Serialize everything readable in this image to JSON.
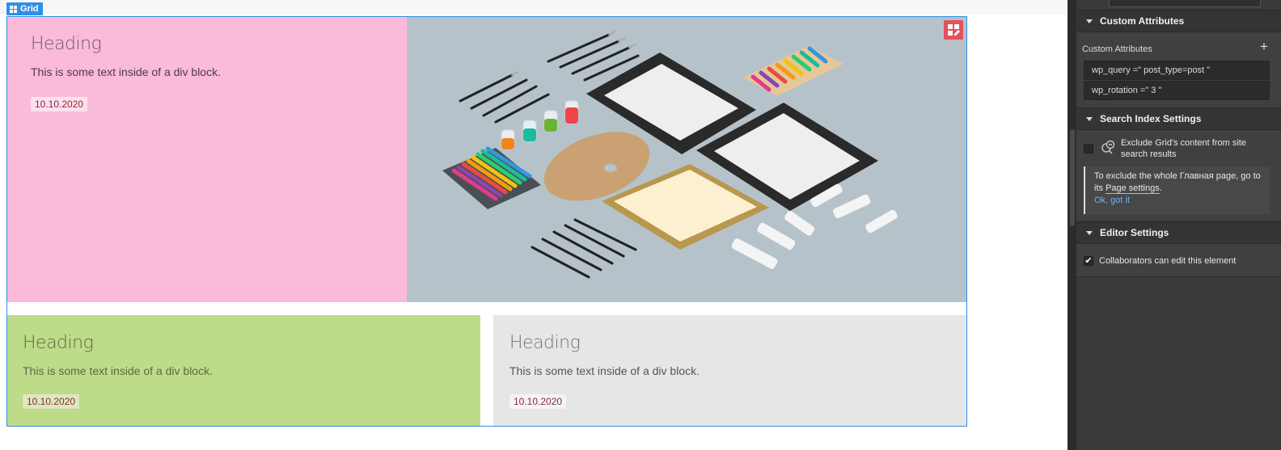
{
  "canvas": {
    "grid_tag": {
      "label": "Grid",
      "icon": "grid-icon"
    },
    "cells": [
      {
        "heading": "Heading",
        "text": "This is some text inside of a div block.",
        "date": "10.10.2020",
        "bg": "#fcbad9"
      },
      {
        "image_alt": "art-supplies-flatlay",
        "bg": "#b6c2c9"
      },
      {
        "heading": "Heading",
        "text": "This is some text inside of a div block.",
        "date": "10.10.2020",
        "bg": "#bddb88"
      },
      {
        "heading": "Heading",
        "text": "This is some text inside of a div block.",
        "date": "10.10.2020",
        "bg": "#e6e6e6"
      }
    ],
    "edit_icon": "grid-edit-icon",
    "accent": "#2f8fe8"
  },
  "panel": {
    "custom_attributes": {
      "title": "Custom Attributes",
      "label": "Custom Attributes",
      "add_icon": "plus-icon",
      "rows": [
        "wp_query =\" post_type=post \"",
        "wp_rotation =\" 3 \""
      ]
    },
    "search_index": {
      "title": "Search Index Settings",
      "checkbox_label": "Exclude Grid's content from site search results",
      "checked": false,
      "icon": "search-exclude-icon",
      "info_prefix": "To exclude the whole Главная page, go to its ",
      "info_link": "Page settings",
      "info_suffix": ".",
      "dismiss": "Ok, got it"
    },
    "editor_settings": {
      "title": "Editor Settings",
      "checkbox_label": "Collaborators can edit this element",
      "checked": true
    }
  }
}
